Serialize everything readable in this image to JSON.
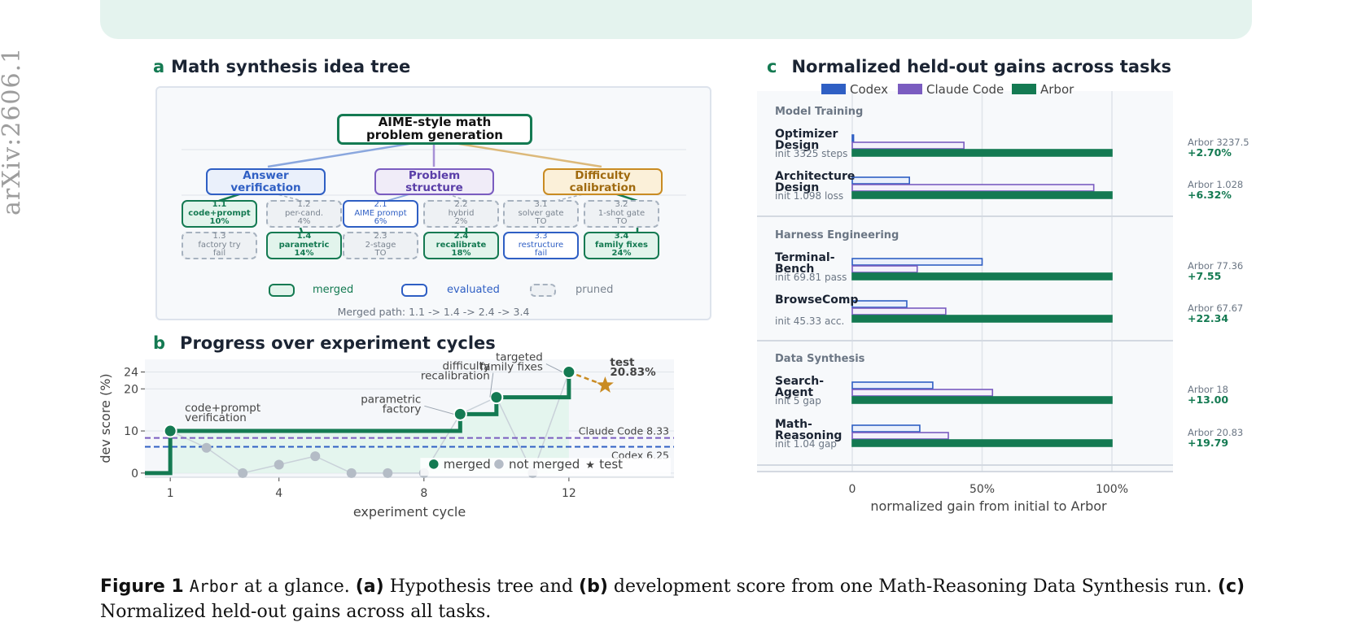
{
  "watermark": "arXiv:2606.1",
  "panel_a": {
    "label": "a",
    "title": "Math synthesis idea tree",
    "root": "AIME-style math problem generation",
    "branches": [
      {
        "label": "Answer verification"
      },
      {
        "label": "Problem structure"
      },
      {
        "label": "Difficulty calibration"
      }
    ],
    "leaves": [
      {
        "id": "1.1",
        "text": "code+prompt",
        "value": "10%",
        "status": "merged"
      },
      {
        "id": "1.2",
        "text": "per-cand.",
        "value": "4%",
        "status": "pruned"
      },
      {
        "id": "2.1",
        "text": "AIME prompt",
        "value": "6%",
        "status": "evaluated"
      },
      {
        "id": "2.2",
        "text": "hybrid",
        "value": "2%",
        "status": "pruned"
      },
      {
        "id": "3.1",
        "text": "solver gate",
        "value": "TO",
        "status": "pruned"
      },
      {
        "id": "3.2",
        "text": "1-shot gate",
        "value": "TO",
        "status": "pruned"
      },
      {
        "id": "1.3",
        "text": "factory try",
        "value": "fail",
        "status": "pruned"
      },
      {
        "id": "1.4",
        "text": "parametric",
        "value": "14%",
        "status": "merged"
      },
      {
        "id": "2.3",
        "text": "2-stage",
        "value": "TO",
        "status": "pruned"
      },
      {
        "id": "2.4",
        "text": "recalibrate",
        "value": "18%",
        "status": "merged"
      },
      {
        "id": "3.3",
        "text": "restructure",
        "value": "fail",
        "status": "evaluated"
      },
      {
        "id": "3.4",
        "text": "family fixes",
        "value": "24%",
        "status": "merged"
      }
    ],
    "legend": {
      "merged": "merged",
      "evaluated": "evaluated",
      "pruned": "pruned"
    },
    "merged_path": "Merged path: 1.1 -> 1.4 -> 2.4 -> 3.4",
    "colors": {
      "merged": "#147a52",
      "evaluated": "#2f5fc4",
      "pruned": "#a7b2bf",
      "orange": "#c98b22"
    }
  },
  "panel_b": {
    "label": "b",
    "title": "Progress over experiment cycles"
  },
  "panel_c": {
    "label": "c",
    "title": "Normalized held-out gains across tasks"
  },
  "chart_data": [
    {
      "type": "line",
      "title": "Progress over experiment cycles",
      "xlabel": "experiment cycle",
      "ylabel": "dev score (%)",
      "xlim": [
        0.3,
        14.9
      ],
      "ylim": [
        -1,
        27
      ],
      "xticks": [
        1,
        4,
        8,
        12
      ],
      "yticks": [
        0,
        10,
        20,
        24
      ],
      "series": [
        {
          "name": "merged",
          "points": [
            {
              "x": 1,
              "y": 10
            },
            {
              "x": 9,
              "y": 14
            },
            {
              "x": 10,
              "y": 18
            },
            {
              "x": 12,
              "y": 24
            }
          ]
        },
        {
          "name": "not merged",
          "points": [
            {
              "x": 2,
              "y": 6
            },
            {
              "x": 3,
              "y": 0
            },
            {
              "x": 4,
              "y": 2
            },
            {
              "x": 5,
              "y": 4
            },
            {
              "x": 6,
              "y": 0
            },
            {
              "x": 7,
              "y": 0
            },
            {
              "x": 8,
              "y": 0
            },
            {
              "x": 11,
              "y": 0
            }
          ]
        },
        {
          "name": "test",
          "points": [
            {
              "x": 13,
              "y": 20.83
            }
          ]
        }
      ],
      "baselines": [
        {
          "name": "Claude Code",
          "value": 8.33,
          "label": "Claude Code 8.33",
          "color": "#7a5cc0"
        },
        {
          "name": "Codex",
          "value": 6.25,
          "label": "Codex 6.25",
          "color": "#2f5fc4"
        }
      ],
      "annotations": [
        {
          "text": [
            "code+prompt",
            "verification"
          ],
          "x": 1,
          "y": 10
        },
        {
          "text": [
            "parametric",
            "factory"
          ],
          "x": 9,
          "y": 14
        },
        {
          "text": [
            "difficulty",
            "recalibration"
          ],
          "x": 10,
          "y": 18
        },
        {
          "text": [
            "targeted",
            "family fixes"
          ],
          "x": 12,
          "y": 24
        },
        {
          "text": [
            "test",
            "20.83%"
          ],
          "x": 13,
          "y": 20.83
        }
      ],
      "legend": [
        "merged",
        "not merged",
        "test"
      ],
      "colors": {
        "merged": "#147a52",
        "not_merged": "#b4bcc6",
        "test": "#c98b22",
        "fill": "#e2f4ec"
      }
    },
    {
      "type": "bar",
      "orientation": "horizontal",
      "title": "Normalized held-out gains across tasks",
      "xlabel": "normalized gain from initial to Arbor",
      "xlim": [
        0,
        1.25
      ],
      "xticks": [
        {
          "value": 0,
          "label": "0"
        },
        {
          "value": 0.5,
          "label": "50%"
        },
        {
          "value": 1.0,
          "label": "100%"
        }
      ],
      "legend": [
        {
          "name": "Codex",
          "color": "#2f5fc4"
        },
        {
          "name": "Claude Code",
          "color": "#7a5cc0"
        },
        {
          "name": "Arbor",
          "color": "#147a52"
        }
      ],
      "groups": [
        {
          "name": "Model Training",
          "tasks": [
            {
              "name": [
                "Optimizer",
                "Design"
              ],
              "init": "init 3325 steps",
              "arbor": "Arbor 3237.5",
              "gain": "+2.70%",
              "codex": 0.005,
              "claude_code": 0.43,
              "arbor_norm": 1.0
            },
            {
              "name": [
                "Architecture",
                "Design"
              ],
              "init": "init 1.098 loss",
              "arbor": "Arbor 1.028",
              "gain": "+6.32%",
              "codex": 0.22,
              "claude_code": 0.93,
              "arbor_norm": 1.0
            }
          ]
        },
        {
          "name": "Harness Engineering",
          "tasks": [
            {
              "name": [
                "Terminal-",
                "Bench"
              ],
              "init": "init 69.81 pass",
              "arbor": "Arbor 77.36",
              "gain": "+7.55",
              "codex": 0.5,
              "claude_code": 0.25,
              "arbor_norm": 1.0
            },
            {
              "name": [
                "BrowseComp"
              ],
              "init": "init 45.33 acc.",
              "arbor": "Arbor 67.67",
              "gain": "+22.34",
              "codex": 0.21,
              "claude_code": 0.36,
              "arbor_norm": 1.0
            }
          ]
        },
        {
          "name": "Data Synthesis",
          "tasks": [
            {
              "name": [
                "Search-",
                "Agent"
              ],
              "init": "init 5 gap",
              "arbor": "Arbor 18",
              "gain": "+13.00",
              "codex": 0.31,
              "claude_code": 0.54,
              "arbor_norm": 1.0
            },
            {
              "name": [
                "Math-",
                "Reasoning"
              ],
              "init": "init 1.04 gap",
              "arbor": "Arbor 20.83",
              "gain": "+19.79",
              "codex": 0.26,
              "claude_code": 0.37,
              "arbor_norm": 1.0
            }
          ]
        }
      ]
    }
  ],
  "caption": {
    "fig": "Figure 1",
    "name": "Arbor",
    "t1": " at a glance. ",
    "a": "(a)",
    "t2": " Hypothesis tree and ",
    "b": "(b)",
    "t3": " development score from one Math-Reasoning Data Synthesis run. ",
    "c": "(c)",
    "t4": " Normalized held-out gains across all tasks."
  }
}
